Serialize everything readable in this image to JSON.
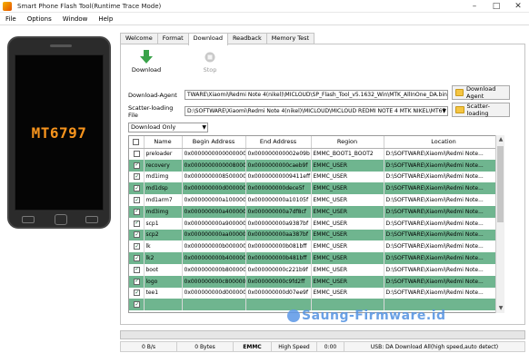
{
  "window": {
    "title": "Smart Phone Flash Tool(Runtime Trace Mode)"
  },
  "menu": [
    "File",
    "Options",
    "Window",
    "Help"
  ],
  "phone": {
    "chip_label": "MT6797"
  },
  "tabs": [
    "Welcome",
    "Format",
    "Download",
    "Readback",
    "Memory Test"
  ],
  "active_tab": "Download",
  "toolbar": {
    "download_label": "Download",
    "stop_label": "Stop"
  },
  "download_agent": {
    "label": "Download-Agent",
    "path": "TWARE\\Xiaomi\\Redmi Note 4(nikel)\\MICLOUD\\SP_Flash_Tool_v5.1632_Win\\MTK_AllInOne_DA.bin",
    "button": "Download Agent"
  },
  "scatter": {
    "label": "Scatter-loading File",
    "path": "D:\\SOFTWARE\\Xiaomi\\Redmi Note 4(nikel)\\MICLOUD\\MICLOUD REDMI NOTE 4 MTK NIKEL\\MT67",
    "button": "Scatter-loading"
  },
  "mode": "Download Only",
  "table": {
    "headers": [
      "",
      "Name",
      "Begin Address",
      "End Address",
      "Region",
      "Location"
    ],
    "rows": [
      {
        "checked": false,
        "name": "preloader",
        "begin": "0x0000000000000000",
        "end": "0x000000000002e09b",
        "region": "EMMC_BOOT1_BOOT2",
        "location": "D:\\SOFTWARE\\Xiaomi\\Redmi Note..."
      },
      {
        "checked": true,
        "name": "recovery",
        "begin": "0x0000000000008000",
        "end": "0x0000000000caeb9f",
        "region": "EMMC_USER",
        "location": "D:\\SOFTWARE\\Xiaomi\\Redmi Note..."
      },
      {
        "checked": true,
        "name": "md1img",
        "begin": "0x0000000008500000",
        "end": "0x00000000009411eff",
        "region": "EMMC_USER",
        "location": "D:\\SOFTWARE\\Xiaomi\\Redmi Note..."
      },
      {
        "checked": true,
        "name": "md1dsp",
        "begin": "0x000000000d000000",
        "end": "0x000000000dece5f",
        "region": "EMMC_USER",
        "location": "D:\\SOFTWARE\\Xiaomi\\Redmi Note..."
      },
      {
        "checked": true,
        "name": "md1arm7",
        "begin": "0x000000000a100000",
        "end": "0x000000000a10105f",
        "region": "EMMC_USER",
        "location": "D:\\SOFTWARE\\Xiaomi\\Redmi Note..."
      },
      {
        "checked": true,
        "name": "md3img",
        "begin": "0x000000000a400000",
        "end": "0x000000000a7df8cf",
        "region": "EMMC_USER",
        "location": "D:\\SOFTWARE\\Xiaomi\\Redmi Note..."
      },
      {
        "checked": true,
        "name": "scp1",
        "begin": "0x000000000a900000",
        "end": "0x000000000a9387bf",
        "region": "EMMC_USER",
        "location": "D:\\SOFTWARE\\Xiaomi\\Redmi Note..."
      },
      {
        "checked": true,
        "name": "scp2",
        "begin": "0x000000000aa00000",
        "end": "0x000000000aa387bf",
        "region": "EMMC_USER",
        "location": "D:\\SOFTWARE\\Xiaomi\\Redmi Note..."
      },
      {
        "checked": true,
        "name": "lk",
        "begin": "0x000000000b000000",
        "end": "0x000000000b081bff",
        "region": "EMMC_USER",
        "location": "D:\\SOFTWARE\\Xiaomi\\Redmi Note..."
      },
      {
        "checked": true,
        "name": "lk2",
        "begin": "0x000000000b400000",
        "end": "0x000000000b481bff",
        "region": "EMMC_USER",
        "location": "D:\\SOFTWARE\\Xiaomi\\Redmi Note..."
      },
      {
        "checked": true,
        "name": "boot",
        "begin": "0x000000000b800000",
        "end": "0x000000000c221b9f",
        "region": "EMMC_USER",
        "location": "D:\\SOFTWARE\\Xiaomi\\Redmi Note..."
      },
      {
        "checked": true,
        "name": "logo",
        "begin": "0x000000000c800000",
        "end": "0x000000000c9fd2ff",
        "region": "EMMC_USER",
        "location": "D:\\SOFTWARE\\Xiaomi\\Redmi Note..."
      },
      {
        "checked": true,
        "name": "tee1",
        "begin": "0x000000000d000000",
        "end": "0x000000000d07ee9f",
        "region": "EMMC_USER",
        "location": "D:\\SOFTWARE\\Xiaomi\\Redmi Note..."
      },
      {
        "checked": true,
        "name": "",
        "begin": "",
        "end": "",
        "region": "",
        "location": ""
      }
    ]
  },
  "progress": {
    "percent": 0
  },
  "status": {
    "speed": "0 B/s",
    "bytes": "0 Bytes",
    "storage": "EMMC",
    "usb_speed": "High Speed",
    "time": "0:00",
    "message": "USB: DA Download All(high speed,auto detect)"
  },
  "watermark": "Saung-Firmware.id",
  "colors": {
    "row_highlight": "#6fb58f",
    "chip_orange": "#f7941d",
    "download_arrow": "#3aa34a"
  }
}
